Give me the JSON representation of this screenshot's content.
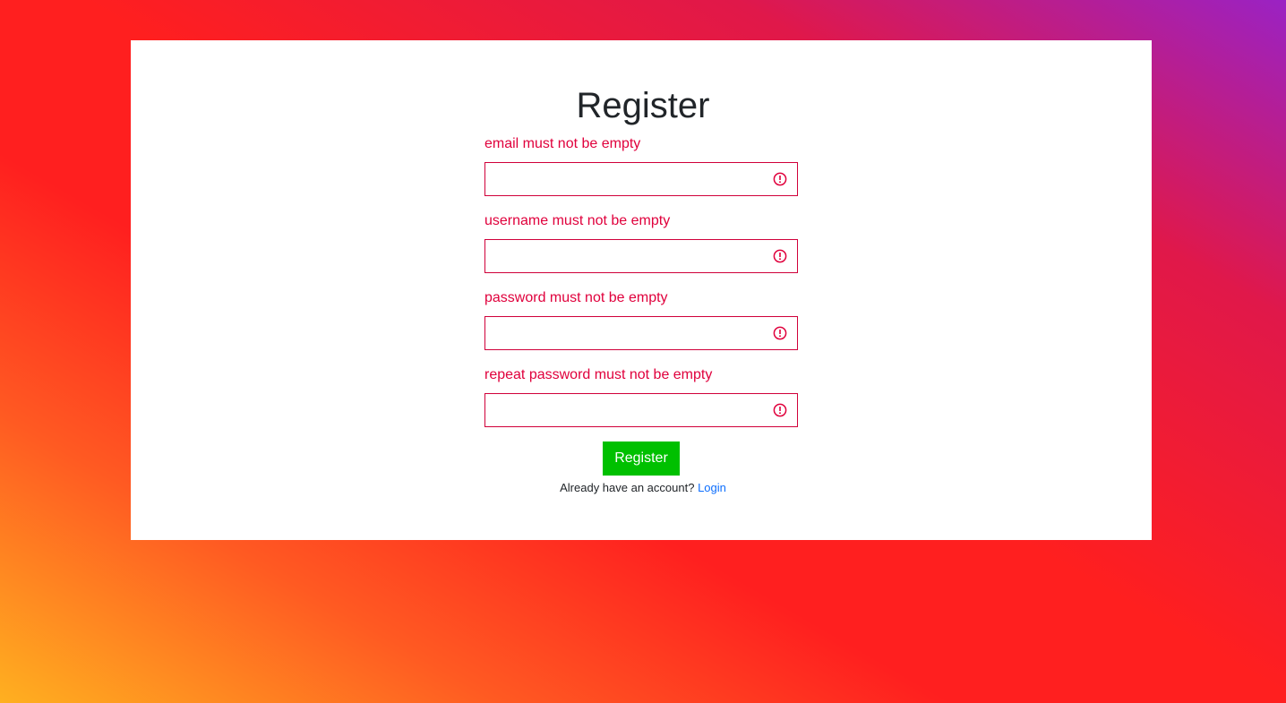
{
  "form": {
    "title": "Register",
    "fields": [
      {
        "name": "email",
        "error": "email must not be empty",
        "value": "",
        "icon": "alert-circle-icon"
      },
      {
        "name": "username",
        "error": "username must not be empty",
        "value": "",
        "icon": "alert-circle-icon"
      },
      {
        "name": "password",
        "error": "password must not be empty",
        "value": "",
        "icon": "alert-circle-icon"
      },
      {
        "name": "repeat-password",
        "error": "repeat password must not be empty",
        "value": "",
        "icon": "alert-circle-icon"
      }
    ],
    "submit_label": "Register",
    "footer_text": "Already have an account?",
    "login_link": "Login"
  },
  "colors": {
    "error": "#e0003c",
    "button": "#00c000",
    "link": "#0d6efd"
  }
}
